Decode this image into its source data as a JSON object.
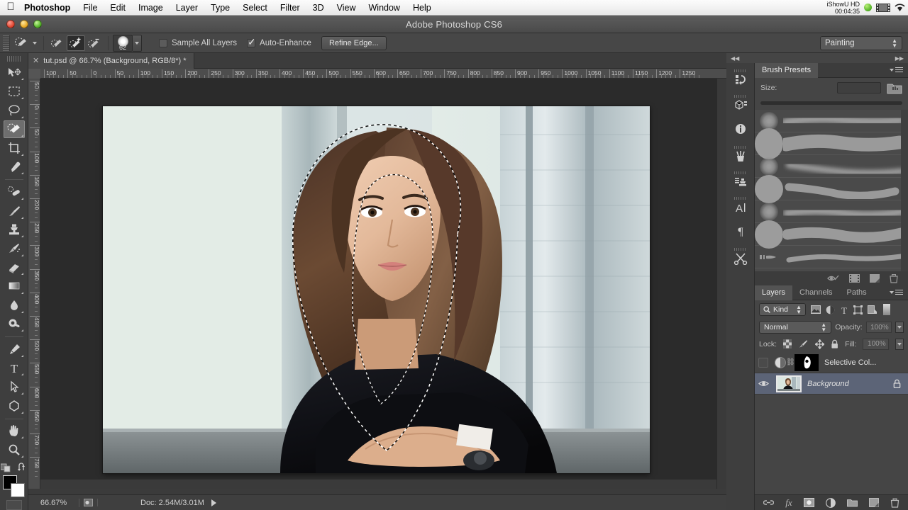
{
  "macbar": {
    "apple_icon": "apple-logo",
    "app_name": "Photoshop",
    "menus": [
      "File",
      "Edit",
      "Image",
      "Layer",
      "Type",
      "Select",
      "Filter",
      "3D",
      "View",
      "Window",
      "Help"
    ],
    "recorder_name": "iShowU HD",
    "recorder_time": "00:04:35",
    "status_icons": [
      "green-record-dot",
      "film-icon",
      "wifi-icon"
    ]
  },
  "titlebar": {
    "title": "Adobe Photoshop CS6",
    "buttons": [
      "close",
      "minimize",
      "zoom"
    ]
  },
  "options_bar": {
    "tool_icon": "quick-selection-tool-icon",
    "modes": [
      "new-selection",
      "add-to-selection",
      "subtract-from-selection"
    ],
    "active_mode_index": 1,
    "brush_size": "62",
    "sample_all_layers": {
      "label": "Sample All Layers",
      "checked": false
    },
    "auto_enhance": {
      "label": "Auto-Enhance",
      "checked": true
    },
    "refine_edge": "Refine Edge...",
    "workspace": "Painting"
  },
  "document": {
    "tab_title": "tut.psd @ 66.7% (Background, RGB/8*) *",
    "close_glyph": "✕"
  },
  "rulers": {
    "horizontal": [
      "100",
      "50",
      "0",
      "50",
      "100",
      "150",
      "200",
      "250",
      "300",
      "350",
      "400",
      "450",
      "500",
      "550",
      "600",
      "650",
      "700",
      "750",
      "800",
      "850",
      "900",
      "950",
      "1000",
      "1050",
      "1100",
      "1150",
      "1200",
      "1250"
    ],
    "vertical": [
      "50",
      "0",
      "50",
      "100",
      "150",
      "200",
      "250",
      "300",
      "350",
      "400",
      "450",
      "500",
      "550",
      "600",
      "650",
      "700",
      "750"
    ]
  },
  "tools": [
    {
      "name": "move-tool",
      "glyph": "move"
    },
    {
      "name": "rectangular-marquee-tool",
      "glyph": "marquee"
    },
    {
      "name": "lasso-tool",
      "glyph": "lasso"
    },
    {
      "name": "quick-selection-tool",
      "glyph": "quickselect",
      "active": true
    },
    {
      "name": "crop-tool",
      "glyph": "crop"
    },
    {
      "name": "eyedropper-tool",
      "glyph": "eyedropper"
    },
    {
      "name": "spot-healing-brush-tool",
      "glyph": "healing"
    },
    {
      "name": "brush-tool",
      "glyph": "brush"
    },
    {
      "name": "clone-stamp-tool",
      "glyph": "stamp"
    },
    {
      "name": "history-brush-tool",
      "glyph": "historybrush"
    },
    {
      "name": "eraser-tool",
      "glyph": "eraser"
    },
    {
      "name": "gradient-tool",
      "glyph": "gradient"
    },
    {
      "name": "blur-tool",
      "glyph": "blur"
    },
    {
      "name": "dodge-tool",
      "glyph": "dodge"
    },
    {
      "name": "pen-tool",
      "glyph": "pen"
    },
    {
      "name": "horizontal-type-tool",
      "glyph": "type"
    },
    {
      "name": "path-selection-tool",
      "glyph": "pathselect"
    },
    {
      "name": "polygon-shape-tool",
      "glyph": "shape"
    },
    {
      "name": "hand-tool",
      "glyph": "hand"
    },
    {
      "name": "zoom-tool",
      "glyph": "zoom"
    }
  ],
  "color_swatches": {
    "foreground": "#000000",
    "background": "#ffffff"
  },
  "status_bar": {
    "zoom": "66.67%",
    "doc_info": "Doc: 2.54M/3.01M"
  },
  "icon_dock": [
    {
      "name": "history-panel-icon",
      "glyph": "history"
    },
    {
      "name": "3d-panel-icon",
      "glyph": "cube"
    },
    {
      "name": "info-panel-icon",
      "glyph": "info"
    },
    {
      "name": "brush-panel-icon",
      "glyph": "brushes"
    },
    {
      "name": "clone-source-panel-icon",
      "glyph": "clonesrc"
    },
    {
      "name": "character-panel-icon",
      "glyph": "char"
    },
    {
      "name": "paragraph-panel-icon",
      "glyph": "para"
    },
    {
      "name": "tool-presets-panel-icon",
      "glyph": "scissors"
    }
  ],
  "brush_presets_panel": {
    "tab_label": "Brush Presets",
    "size_label": "Size:",
    "size_value": "",
    "presets": [
      {
        "thumb": 13,
        "soft": true,
        "stroke": "soft-wide"
      },
      {
        "thumb": 22,
        "soft": false,
        "stroke": "hard-wide"
      },
      {
        "thumb": 13,
        "soft": true,
        "stroke": "soft-taper"
      },
      {
        "thumb": 20,
        "soft": false,
        "stroke": "hard-taper"
      },
      {
        "thumb": 13,
        "soft": true,
        "stroke": "soft-wave"
      },
      {
        "thumb": 20,
        "soft": false,
        "stroke": "hard-wave"
      },
      {
        "thumb": 9,
        "soft": false,
        "stroke": "flat-taper"
      }
    ]
  },
  "layers_panel": {
    "tabs": [
      "Layers",
      "Channels",
      "Paths"
    ],
    "active_tab": "Layers",
    "filter": {
      "label": "Kind",
      "icons": [
        "pixel-filter-icon",
        "adjustment-filter-icon",
        "type-filter-icon",
        "shape-filter-icon",
        "smartobject-filter-icon"
      ]
    },
    "blend_mode": "Normal",
    "opacity_label": "Opacity:",
    "opacity_value": "100%",
    "lock_label": "Lock:",
    "fill_label": "Fill:",
    "fill_value": "100%",
    "lock_icons": [
      "lock-transparent-pixels-icon",
      "lock-image-pixels-icon",
      "lock-position-icon",
      "lock-all-icon"
    ],
    "layers": [
      {
        "name": "Selective Col...",
        "visible": false,
        "selected": false,
        "type": "adjustment",
        "italic": false,
        "locked": false
      },
      {
        "name": "Background",
        "visible": true,
        "selected": true,
        "type": "image",
        "italic": true,
        "locked": true
      }
    ],
    "bottom_buttons": [
      "link-layers-icon",
      "fx-icon",
      "add-mask-icon",
      "adjustment-layer-icon",
      "new-group-icon",
      "new-layer-icon",
      "delete-layer-icon"
    ],
    "top_buttons": [
      "eye-toggle-icon",
      "filmstrip-icon",
      "panel-dock-icon",
      "trash-icon"
    ]
  }
}
